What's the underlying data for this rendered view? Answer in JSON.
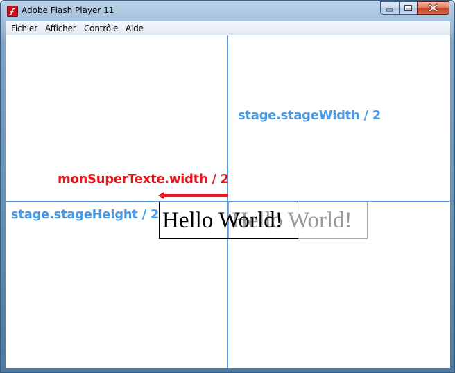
{
  "window": {
    "title": "Adobe Flash Player 11",
    "icon": "flash-player-icon",
    "controls": {
      "minimize": "minimize-icon",
      "maximize": "maximize-icon",
      "close": "close-icon"
    }
  },
  "menubar": {
    "items": [
      {
        "label": "Fichier"
      },
      {
        "label": "Afficher"
      },
      {
        "label": "Contrôle"
      },
      {
        "label": "Aide"
      }
    ]
  },
  "stage": {
    "background": "#ffffff",
    "guide_color": "#5a9ae0",
    "labels": {
      "stage_width": "stage.stageWidth / 2",
      "stage_height": "stage.stageHeight / 2",
      "text_width": "monSuperTexte.width / 2"
    },
    "label_colors": {
      "blue": "#4a9be8",
      "red": "#e8141c"
    },
    "text_fields": {
      "main": "Hello World!",
      "ghost": "Hello World!"
    }
  }
}
